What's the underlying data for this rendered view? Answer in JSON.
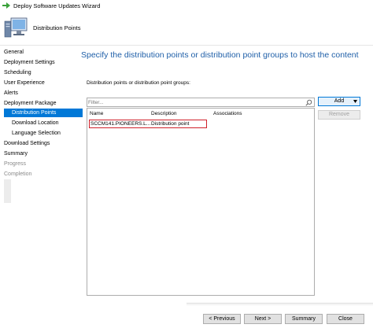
{
  "window": {
    "title": "Deploy Software Updates Wizard"
  },
  "header": {
    "title": "Distribution Points"
  },
  "nav": {
    "items": [
      {
        "label": "General"
      },
      {
        "label": "Deployment Settings"
      },
      {
        "label": "Scheduling"
      },
      {
        "label": "User Experience"
      },
      {
        "label": "Alerts"
      },
      {
        "label": "Deployment Package"
      },
      {
        "label": "Distribution Points"
      },
      {
        "label": "Download Location"
      },
      {
        "label": "Language Selection"
      },
      {
        "label": "Download Settings"
      },
      {
        "label": "Summary"
      },
      {
        "label": "Progress"
      },
      {
        "label": "Completion"
      }
    ]
  },
  "content": {
    "title": "Specify the distribution points or distribution point groups to host the content",
    "list_label": "Distribution points or distribution point groups:",
    "filter_placeholder": "Filter...",
    "columns": {
      "name": "Name",
      "description": "Description",
      "associations": "Associations"
    },
    "rows": [
      {
        "name": "SCCM141.PIONEERS.L...",
        "description": "Distribution point",
        "associations": ""
      }
    ],
    "add_label": "Add",
    "remove_label": "Remove"
  },
  "footer": {
    "previous_label": "< Previous",
    "next_label": "Next >",
    "summary_label": "Summary",
    "close_label": "Close"
  },
  "colors": {
    "accent": "#0078d7",
    "title_blue": "#1f5fa8",
    "highlight_red": "#d0202a"
  }
}
